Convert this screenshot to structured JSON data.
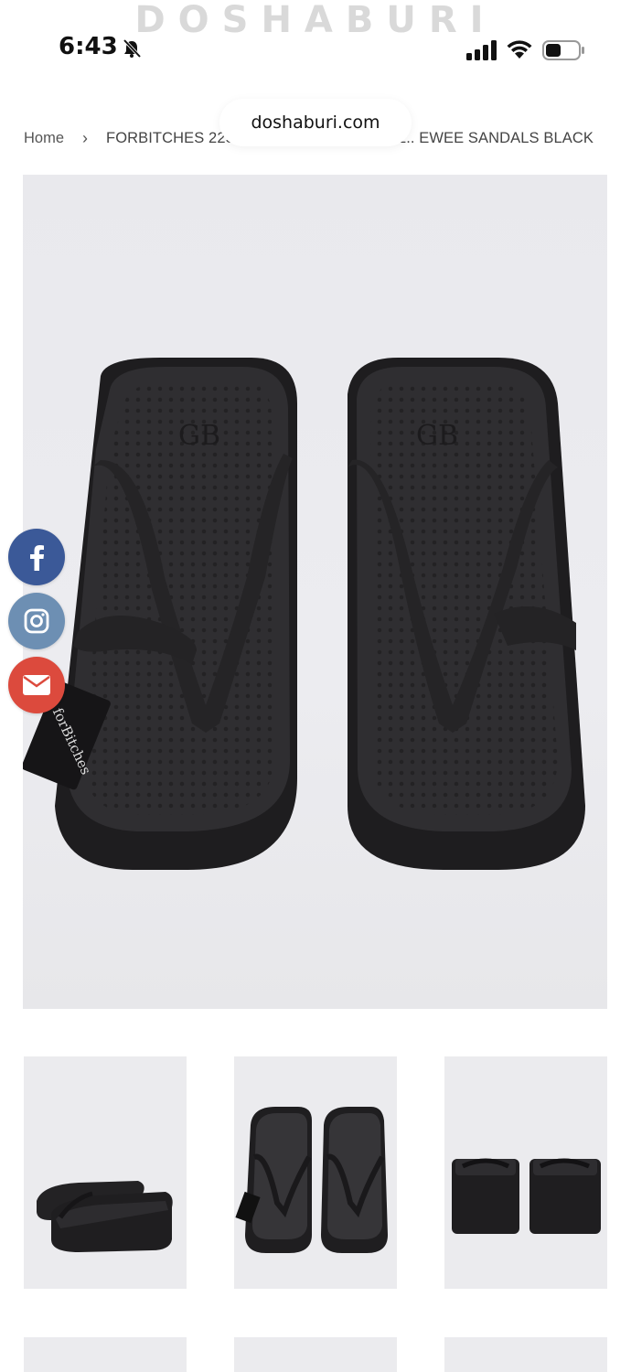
{
  "status_bar": {
    "time": "6:43",
    "icons": [
      "bell-slash-icon",
      "signal-icon",
      "wifi-icon",
      "battery-icon"
    ]
  },
  "brand": {
    "watermark": "DOSHABURI"
  },
  "browser": {
    "url": "doshaburi.com"
  },
  "breadcrumb": {
    "home": "Home",
    "separator": "›",
    "current": "FORBITCHES 22SEHEEDUSE LIT ET ODE.. EWEE SANDALS BLACK"
  },
  "product": {
    "main_image_alt": "Black platform flip-flop sandals, top view",
    "tag_text": "forBitches",
    "sole_logo": "GB"
  },
  "social": {
    "facebook": "facebook-icon",
    "instagram": "instagram-icon",
    "email": "mail-icon"
  },
  "thumbnails": [
    {
      "view": "side"
    },
    {
      "view": "top"
    },
    {
      "view": "back"
    },
    {
      "view": "partial"
    },
    {
      "view": "partial"
    },
    {
      "view": "partial"
    }
  ],
  "colors": {
    "facebook": "#3b5998",
    "instagram": "#6d8fb3",
    "email": "#dc4a3d",
    "sandal": "#2b2a2c",
    "photo_bg": "#ebebee"
  }
}
